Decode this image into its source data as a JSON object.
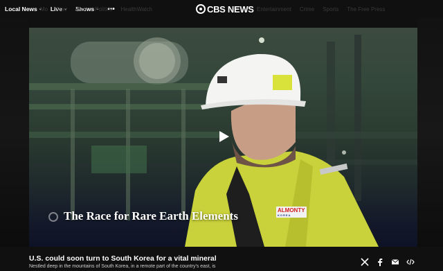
{
  "nav": {
    "left_items": [
      {
        "label": "Local News",
        "has_dropdown": true
      },
      {
        "label": "Live",
        "has_dropdown": true
      },
      {
        "label": "Shows",
        "has_dropdown": true
      }
    ],
    "more_label": "•••",
    "dim_left": [
      "Mo",
      "Trav",
      "Worl",
      "Politics",
      "HealthWatch"
    ],
    "dim_right": [
      "Entertainment",
      "Crime",
      "Sports",
      "The Free Press"
    ],
    "logo_text": "CBS NEWS"
  },
  "video": {
    "caption": "The Race for Rare Earth Elements",
    "brand_badge": "ALMONTY",
    "brand_sub": "KOREA"
  },
  "article": {
    "headline": "U.S. could soon turn to South Korea for a vital mineral",
    "subtext": "Nestled deep in the mountains of South Korea, in a remote part of the country's east, is"
  },
  "share": {
    "icons": [
      "x-icon",
      "facebook-icon",
      "email-icon",
      "embed-icon"
    ]
  },
  "colors": {
    "background": "#101010",
    "accent": "#ffffff"
  }
}
